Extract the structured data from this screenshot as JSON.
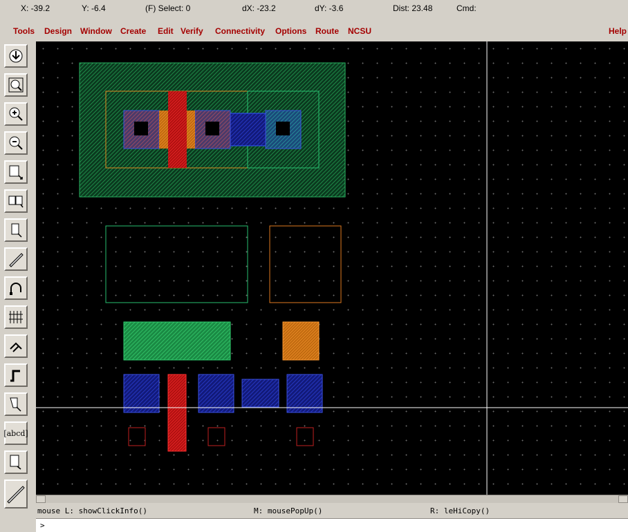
{
  "status": {
    "x": "X: -39.2",
    "y": "Y: -6.4",
    "select": "(F) Select: 0",
    "dx": "dX: -23.2",
    "dy": "dY: -3.6",
    "dist": "Dist: 23.48",
    "cmd": "Cmd:"
  },
  "menu": {
    "tools": "Tools",
    "design": "Design",
    "window": "Window",
    "create": "Create",
    "edit": "Edit",
    "verify": "Verify",
    "connectivity": "Connectivity",
    "options": "Options",
    "route": "Route",
    "ncsu": "NCSU",
    "help": "Help"
  },
  "toolbar": {
    "label_tool": "[abcd]",
    "icons": [
      "save-icon",
      "zoom-fit-icon",
      "zoom-in-icon",
      "zoom-out-icon",
      "stretch-icon",
      "copy-icon",
      "move-icon",
      "ruler-pen-icon",
      "undo-icon",
      "properties-grid-icon",
      "instance-icon",
      "path-icon",
      "select-icon",
      "label-icon",
      "rectangle-icon",
      "ruler-icon"
    ]
  },
  "mouse": {
    "left": "mouse L: showClickInfo()",
    "middle": "M: mousePopUp()",
    "right": "R: leHiCopy()"
  },
  "cmdline": {
    "prompt": ">"
  },
  "colors": {
    "menu": "#a40000",
    "canvas": "#000000",
    "nwell": "#1e8a4a",
    "active": "#1fbf5a",
    "poly": "#e01a1a",
    "metal1": "#2a3bd6",
    "pselect": "#e88a1a",
    "contact": "#000000",
    "cursor": "#ffffff"
  }
}
